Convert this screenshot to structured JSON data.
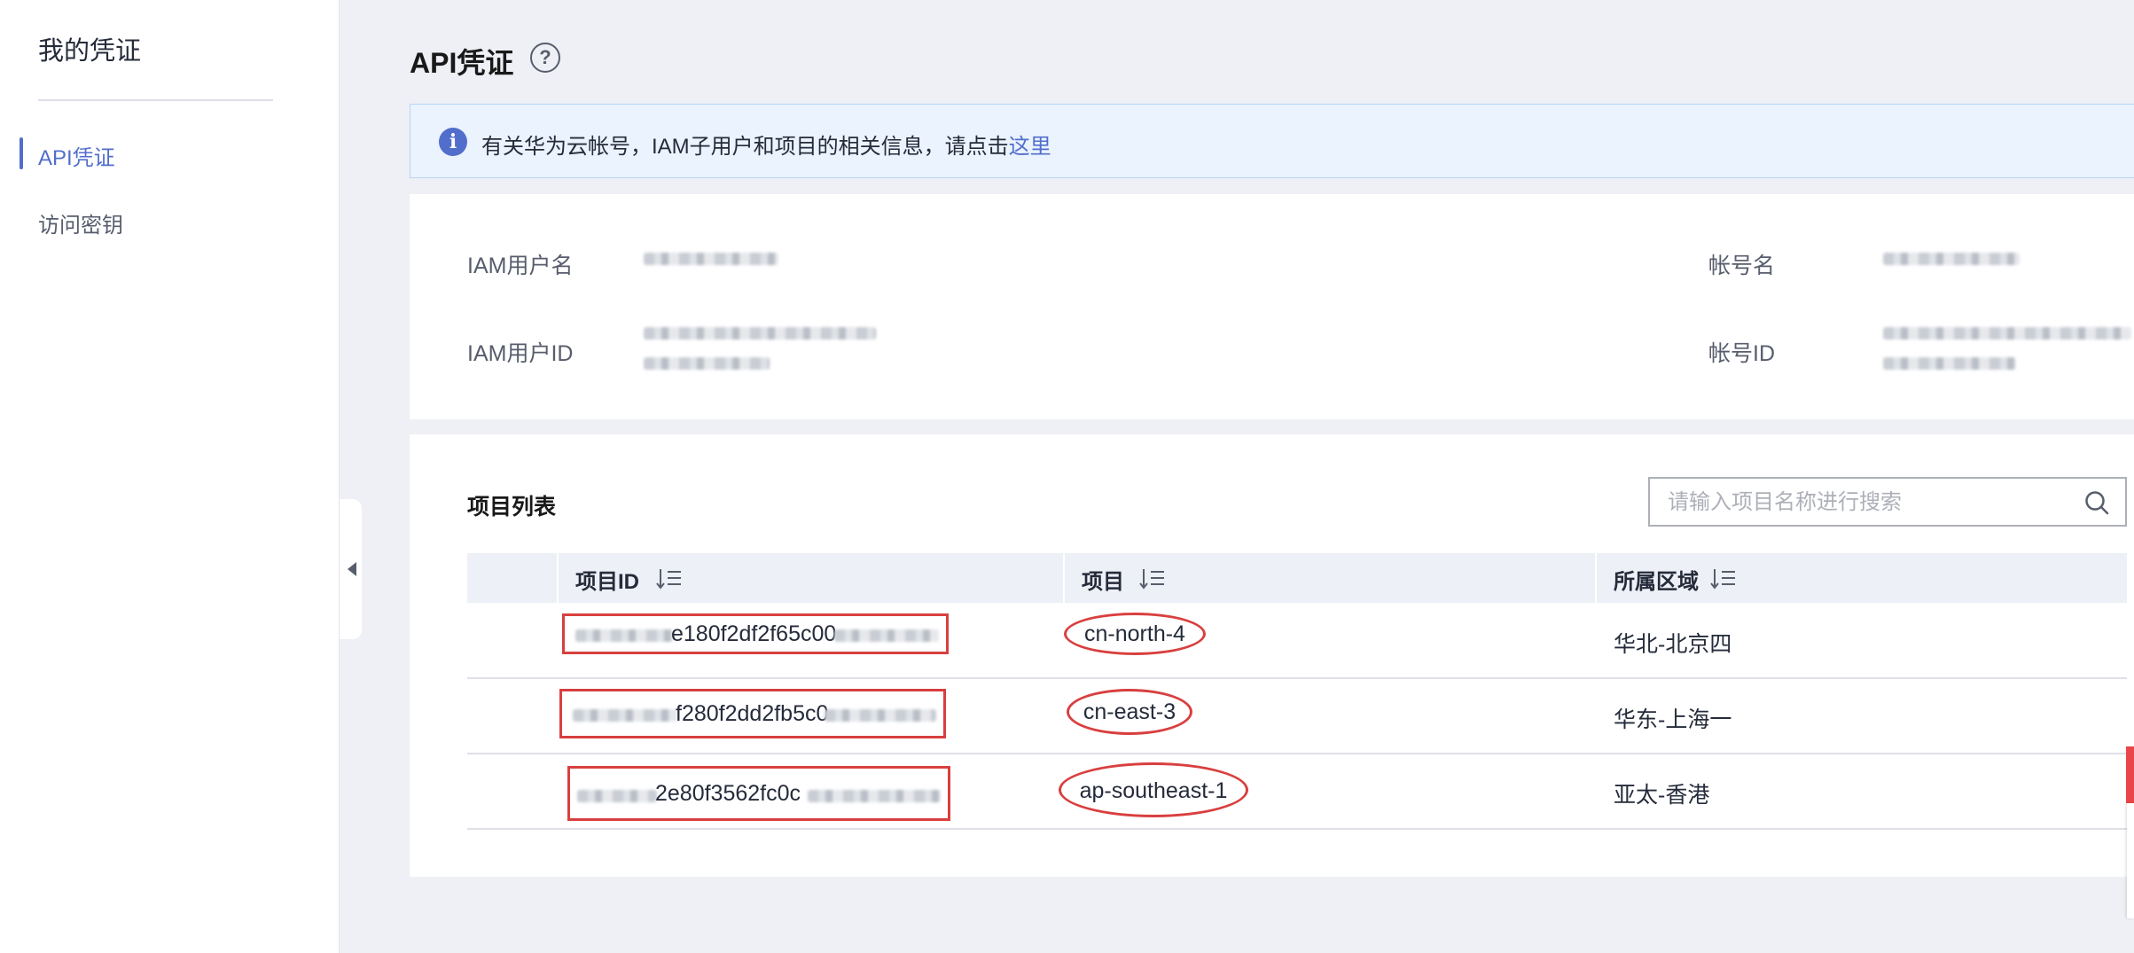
{
  "sidebar": {
    "title": "我的凭证",
    "items": [
      {
        "label": "API凭证",
        "active": true
      },
      {
        "label": "访问密钥",
        "active": false
      }
    ]
  },
  "header": {
    "title": "API凭证",
    "help_icon": "question-circle-icon"
  },
  "info_bar": {
    "icon": "info-icon",
    "text": "有关华为云帐号，IAM子用户和项目的相关信息，请点击",
    "link": "这里"
  },
  "user_info": {
    "iam_username_label": "IAM用户名",
    "iam_userid_label": "IAM用户ID",
    "account_name_label": "帐号名",
    "account_id_label": "帐号ID"
  },
  "projects": {
    "section_title": "项目列表",
    "search": {
      "placeholder": "请输入项目名称进行搜索",
      "value": ""
    },
    "columns": [
      "项目ID",
      "项目",
      "所属区域"
    ],
    "rows": [
      {
        "project_id_visible": "e180f2df2f65c00",
        "project": "cn-north-4",
        "region": "华北-北京四"
      },
      {
        "project_id_visible": "f280f2dd2fb5c0",
        "project": "cn-east-3",
        "region": "华东-上海一"
      },
      {
        "project_id_visible": "2e80f3562fc0c",
        "project": "ap-southeast-1",
        "region": "亚太-香港"
      }
    ]
  },
  "colors": {
    "accent": "#526ecc",
    "annotation_red": "#d93f3f",
    "info_bg": "#eaf3fe",
    "page_bg": "#eef0f5"
  }
}
